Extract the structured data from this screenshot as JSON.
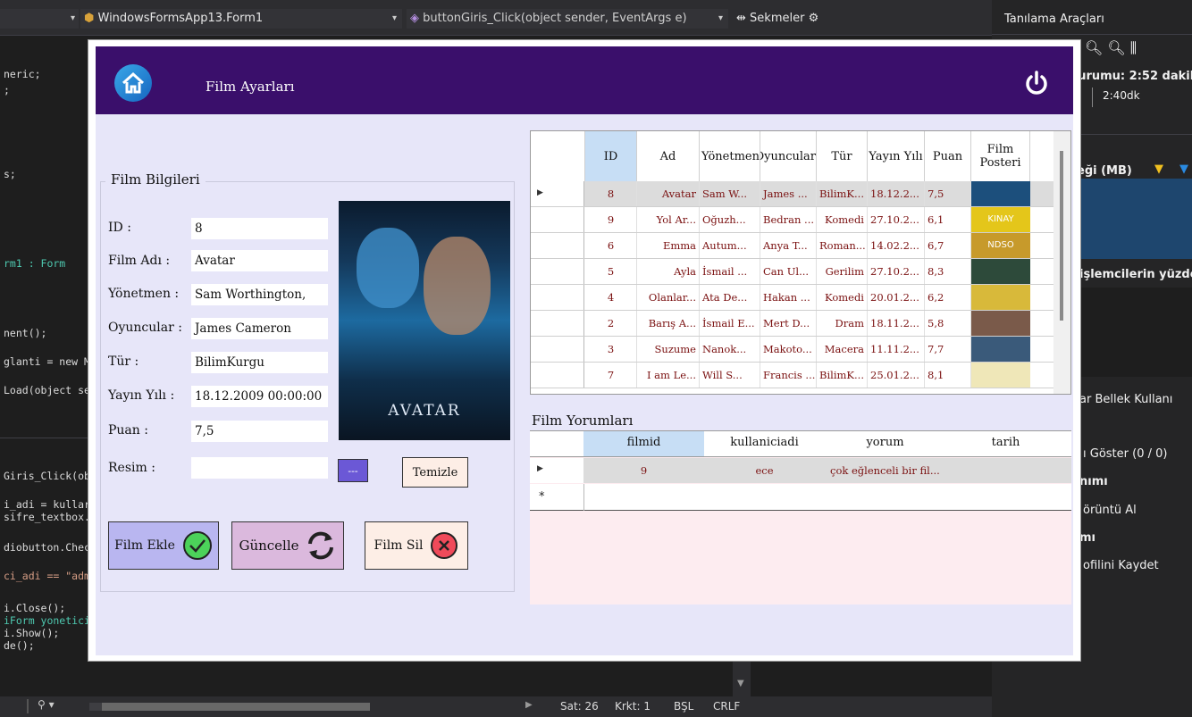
{
  "vs": {
    "dropdown1": "WindowsFormsApp13.Form1",
    "dropdown2": "buttonGiris_Click(object sender, EventArgs e)",
    "dropdown3": "Sekmeler",
    "code_lines": [
      "neric;",
      ";",
      "s;",
      "rm1 : Form",
      "nent();",
      "glanti = new M",
      "Load(object se",
      "Giris_Click(ob",
      "i_adi = kullar",
      "sifre_textbox.",
      "diobutton.Chec",
      "ci_adi == \"adm",
      "i.Close();",
      "iForm yonetici",
      "i.Show();",
      "de();"
    ],
    "status": {
      "line": "Sat: 26",
      "col": "Krkt: 1",
      "mode": "BŞL",
      "eol": "CRLF"
    },
    "right_pane": {
      "title": "Tanılama Araçları",
      "session": "turumu: 2:52 dakil",
      "time_mark": "2:40dk",
      "memory": "eği (MB)",
      "cpu": "işlemcilerin yüzde",
      "tabs": "ar   Bellek Kullanı",
      "events": "ı Göster (0 / 0)",
      "item1": "nımı",
      "item2": "örüntü Al",
      "item3": "mı",
      "item4": "ofilini Kaydet"
    }
  },
  "form": {
    "title": "Film Ayarları",
    "group_title": "Film Bilgileri",
    "fields": [
      {
        "label": "ID :",
        "value": "8"
      },
      {
        "label": "Film Adı :",
        "value": "Avatar"
      },
      {
        "label": "Yönetmen :",
        "value": "Sam Worthington,"
      },
      {
        "label": "Oyuncular :",
        "value": "James Cameron"
      },
      {
        "label": "Tür :",
        "value": "BilimKurgu"
      },
      {
        "label": "Yayın Yılı :",
        "value": "18.12.2009 00:00:00"
      },
      {
        "label": "Puan :",
        "value": "7,5"
      },
      {
        "label": "Resim :",
        "value": ""
      }
    ],
    "browse_label": "---",
    "clear_label": "Temizle",
    "add_label": "Film Ekle",
    "update_label": "Güncelle",
    "delete_label": "Film Sil",
    "poster_title": "AVATAR",
    "poster_colors": {
      "add": "#b9b6f0",
      "update": "#dbb9dd",
      "delete": "#fdeee6",
      "browse": "#6b58d6"
    }
  },
  "films_grid": {
    "headers": [
      "ID",
      "Ad",
      "Yönetmen",
      "Oyuncular",
      "Tür",
      "Yayın Yılı",
      "Puan",
      "Film Posteri"
    ],
    "rows": [
      [
        "8",
        "Avatar",
        "Sam W...",
        "James ...",
        "BilimK...",
        "18.12.2...",
        "7,5"
      ],
      [
        "9",
        "Yol Ar...",
        "Oğuzh...",
        "Bedran ...",
        "Komedi",
        "27.10.2...",
        "6,1"
      ],
      [
        "6",
        "Emma",
        "Autum...",
        "Anya T...",
        "Roman...",
        "14.02.2...",
        "6,7"
      ],
      [
        "5",
        "Ayla",
        "İsmail ...",
        "Can Ul...",
        "Gerilim",
        "27.10.2...",
        "8,3"
      ],
      [
        "4",
        "Olanlar...",
        "Ata De...",
        "Hakan ...",
        "Komedi",
        "20.01.2...",
        "6,2"
      ],
      [
        "2",
        "Barış A...",
        "İsmail E...",
        "Mert D...",
        "Dram",
        "18.11.2...",
        "5,8"
      ],
      [
        "3",
        "Suzume",
        "Nanok...",
        "Makoto...",
        "Macera",
        "11.11.2...",
        "7,7"
      ],
      [
        "7",
        "I am Le...",
        "Will S...",
        "Francis ...",
        "BilimK...",
        "25.01.2...",
        "8,1"
      ]
    ],
    "thumb_colors": [
      "#1c4f7c",
      "#e4c61a",
      "#c79a2b",
      "#2d4a3a",
      "#d8b93a",
      "#7a5a4a",
      "#3a5a7a",
      "#efe7b8"
    ],
    "thumb_texts": [
      "",
      "KINAY",
      "NDSO",
      "",
      "",
      "",
      "",
      ""
    ]
  },
  "comments": {
    "title": "Film Yorumları",
    "headers": [
      "filmid",
      "kullaniciadi",
      "yorum",
      "tarih"
    ],
    "rows": [
      [
        "9",
        "ece",
        "çok eğlenceli bir fil...",
        ""
      ]
    ],
    "new_row_marker": "*"
  }
}
